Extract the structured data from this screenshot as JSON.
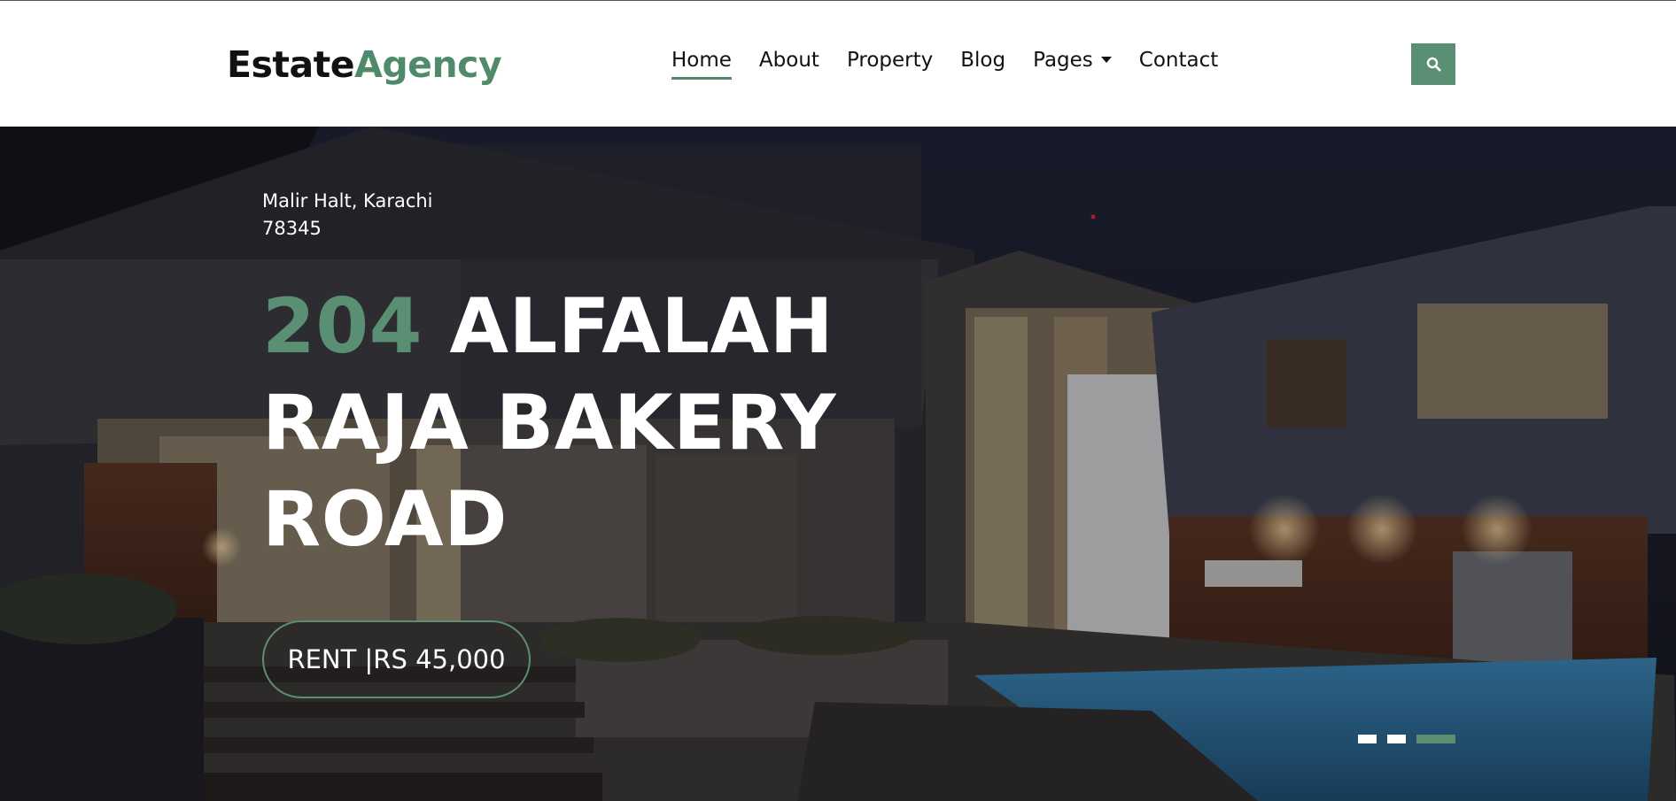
{
  "brand": {
    "part1": "Estate",
    "part2": "Agency"
  },
  "nav": {
    "items": [
      "Home",
      "About",
      "Property",
      "Blog",
      "Pages",
      "Contact"
    ],
    "active": "Home"
  },
  "search": {
    "icon": "search-icon"
  },
  "hero": {
    "address_line1": "Malir Halt, Karachi",
    "address_line2": "78345",
    "title_number": "204",
    "title_line1": "ALFALAH",
    "title_line2": "RAJA BAKERY",
    "title_line3": "ROAD",
    "rent_label": "RENT |RS 45,000"
  },
  "carousel": {
    "slides": 3,
    "active_index": 2
  },
  "colors": {
    "accent": "#5a8f73",
    "text_dark": "#111111",
    "hero_text": "#ffffff"
  }
}
